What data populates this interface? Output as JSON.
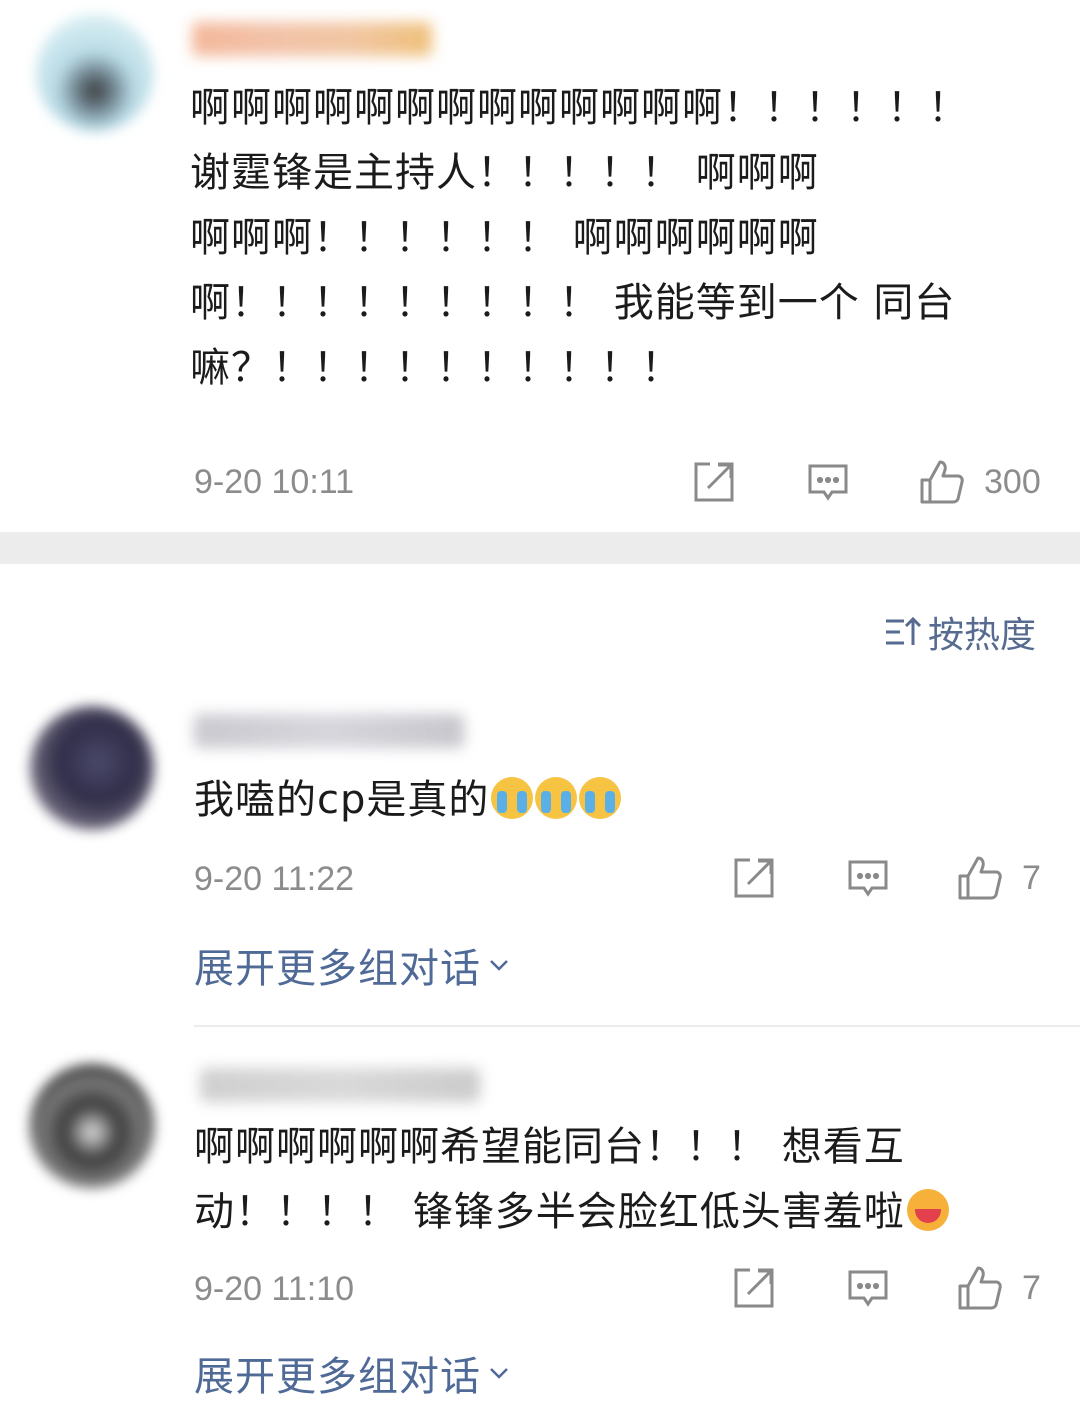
{
  "post": {
    "text_lines": [
      "啊啊啊啊啊啊啊啊啊啊啊啊啊！！！！！！",
      "谢霆锋是主持人！！！！！ 啊啊啊",
      "啊啊啊！！！！！！ 啊啊啊啊啊啊",
      "啊！！！！！！！！！ 我能等到一个 同台",
      "嘛？！！！！！！！！！！"
    ],
    "timestamp": "9-20 10:11",
    "like_count": "300",
    "icons": {
      "share": "share-icon",
      "comment": "comment-icon",
      "like": "thumbs-up-icon"
    }
  },
  "sort": {
    "label": "按热度",
    "icon": "sort-icon"
  },
  "comments": [
    {
      "text": "我嗑的cp是真的",
      "emoji": [
        "crying-face",
        "crying-face",
        "crying-face"
      ],
      "timestamp": "9-20 11:22",
      "like_count": "7",
      "expand_label": "展开更多组对话"
    },
    {
      "text_lines": [
        "啊啊啊啊啊啊希望能同台！！！ 想看互",
        "动！！！！ 锋锋多半会脸红低头害羞啦"
      ],
      "emoji": [
        "blushing-face"
      ],
      "timestamp": "9-20 11:10",
      "like_count": "7",
      "expand_label": "展开更多组对话"
    }
  ],
  "colors": {
    "link": "#4f6a97",
    "meta_text": "#8c8c8c",
    "separator": "#ececec"
  }
}
